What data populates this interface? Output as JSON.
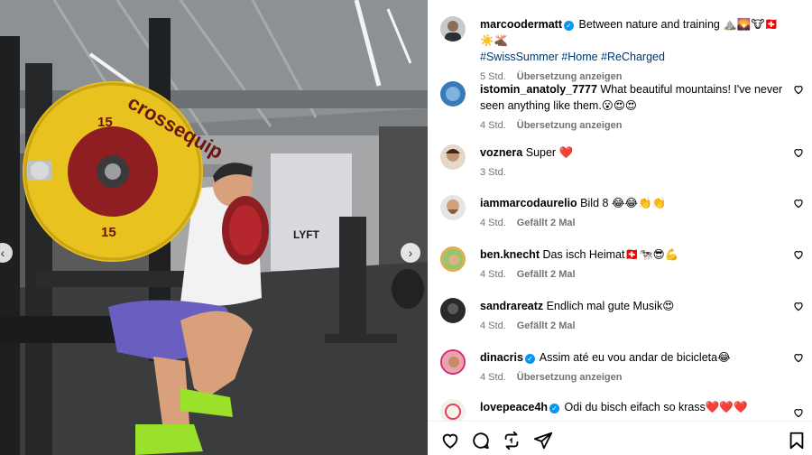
{
  "post": {
    "author": "marcoodermatt",
    "caption": "Between nature and training ⛰️🌄🐮🇨🇭☀️🫎",
    "hashtags": "#SwissSummer #Home #ReCharged",
    "time": "5 Std.",
    "translate": "Übersetzung anzeigen"
  },
  "comments": [
    {
      "user": "istomin_anatoly_7777",
      "verified": false,
      "text": "What beautiful mountains! I've never seen anything like them.😮😍😍",
      "time": "4 Std.",
      "action": "Übersetzung anzeigen"
    },
    {
      "user": "voznera",
      "verified": false,
      "text": "Super ❤️",
      "time": "3 Std.",
      "action": ""
    },
    {
      "user": "iammarcodaurelio",
      "verified": false,
      "text": "Bild 8 😂😂👏👏",
      "time": "4 Std.",
      "action": "Gefällt 2 Mal"
    },
    {
      "user": "ben.knecht",
      "verified": false,
      "text": "Das isch Heimat🇨🇭🐄😎💪",
      "time": "4 Std.",
      "action": "Gefällt 2 Mal"
    },
    {
      "user": "sandrareatz",
      "verified": false,
      "text": "Endlich mal gute Musik😍",
      "time": "4 Std.",
      "action": "Gefällt 2 Mal"
    },
    {
      "user": "dinacris",
      "verified": true,
      "text": "Assim até eu vou andar de bicicleta😂",
      "time": "4 Std.",
      "action": "Übersetzung anzeigen"
    },
    {
      "user": "lovepeace4h",
      "verified": true,
      "text": "Odi du bisch eifach so krass❤️❤️❤️",
      "time": "",
      "action": ""
    }
  ],
  "photo": {
    "plate_brand": "crossequip",
    "plate_weight": "15",
    "wall_text": "LYFT"
  },
  "icons": {
    "like": "heart-icon",
    "comment": "comment-icon",
    "share": "repost-icon",
    "send": "send-icon",
    "save": "bookmark-icon",
    "prev": "chevron-left-icon",
    "next": "chevron-right-icon"
  },
  "colors": {
    "link": "#00376b",
    "verified": "#0095f6",
    "meta": "#737373",
    "plate_yellow": "#e8c21e",
    "plate_red": "#8e1e22",
    "shoe_green": "#9be02b"
  }
}
